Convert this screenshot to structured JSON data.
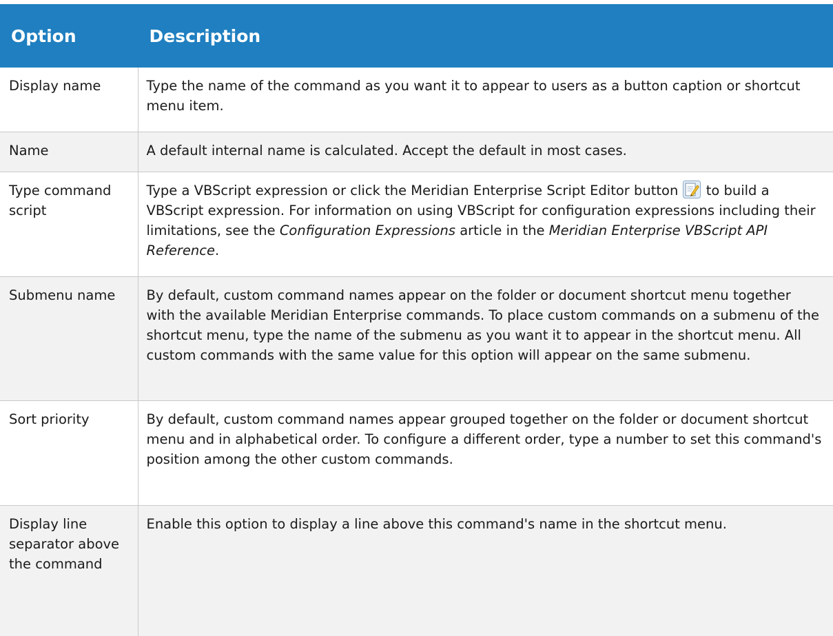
{
  "table": {
    "header": {
      "option": "Option",
      "description": "Description"
    },
    "rows": [
      {
        "option": "Display name",
        "description": "Type the name of the command as you want it to appear to users as a button caption or shortcut menu item."
      },
      {
        "option": "Name",
        "description": "A default internal name is calculated. Accept the default in most cases."
      },
      {
        "option": "Type command script",
        "desc_part1": "Type a VBScript expression or click the Meridian Enterprise Script Editor button ",
        "icon": "script-editor-icon",
        "desc_part2": " to build a VBScript expression.  For information on using VBScript for configuration expressions including their limitations, see the ",
        "desc_em1": "Configuration Expressions",
        "desc_part3": " article in the ",
        "desc_em2": "Meridian Enterprise VBScript API Reference",
        "desc_part4": "."
      },
      {
        "option": "Submenu name",
        "description": "By default, custom command names appear on the folder or document shortcut menu together with the available Meridian Enterprise commands. To place custom commands on a submenu of the shortcut menu, type the name of the submenu as you want it to appear in the shortcut menu. All custom commands with the same value for this option will appear on the same submenu."
      },
      {
        "option": "Sort priority",
        "description": "By default, custom command names appear grouped together on the folder or document shortcut menu and in alphabetical order. To configure a different order, type a number to set this command's position among the other custom commands."
      },
      {
        "option": "Display line separator above the command",
        "description": "Enable this option to display a line above this command's name in the shortcut menu."
      }
    ]
  },
  "colors": {
    "header_bg": "#1f7fc0",
    "header_text": "#ffffff",
    "alt_row_bg": "#f2f2f2",
    "border": "#c9c9c9"
  }
}
